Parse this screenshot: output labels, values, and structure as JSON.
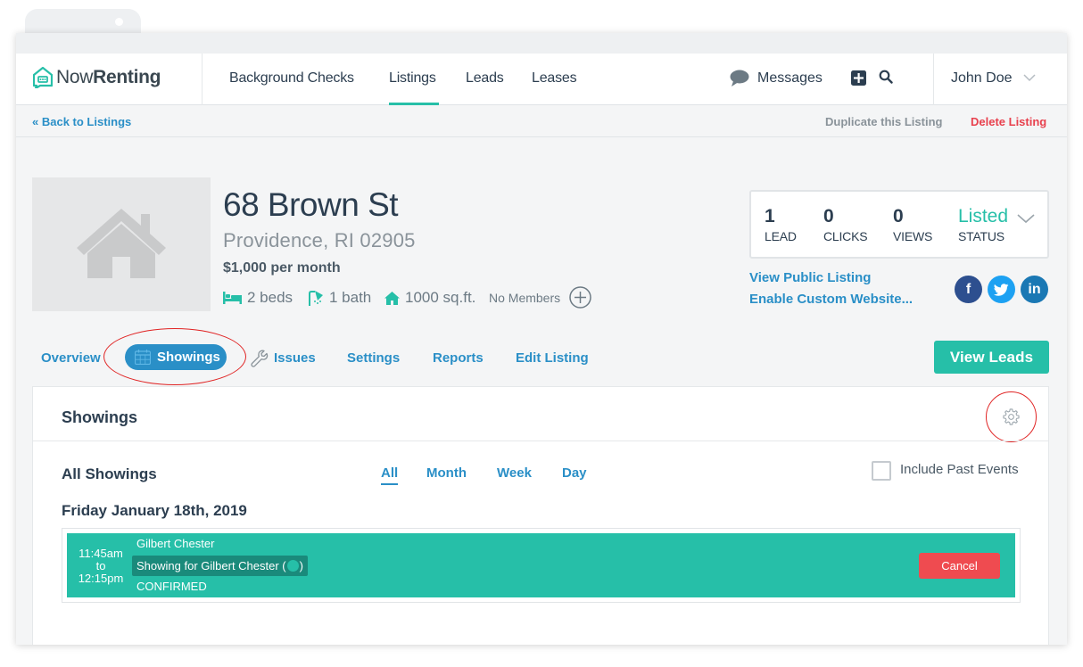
{
  "navbar": {
    "logo_light": "Now",
    "logo_bold": "Renting",
    "items": [
      "Background Checks",
      "Listings",
      "Leads",
      "Leases"
    ],
    "active_item": "Listings",
    "messages_label": "Messages",
    "user_name": "John Doe"
  },
  "subbar": {
    "back_label": "« Back to Listings",
    "duplicate_label": "Duplicate this Listing",
    "delete_label": "Delete Listing"
  },
  "listing": {
    "address_line1": "68 Brown St",
    "address_line2": "Providence, RI 02905",
    "price": "$1,000 per month",
    "beds": "2 beds",
    "baths": "1 bath",
    "sqft": "1000 sq.ft.",
    "members": "No Members"
  },
  "stats": {
    "lead_count": "1",
    "lead_label": "LEAD",
    "clicks_count": "0",
    "clicks_label": "CLICKS",
    "views_count": "0",
    "views_label": "VIEWS",
    "status_value": "Listed",
    "status_label": "STATUS"
  },
  "links": {
    "view_public": "View Public Listing",
    "custom_website": "Enable Custom Website..."
  },
  "social": {
    "facebook": "f",
    "twitter": "t",
    "linkedin": "in"
  },
  "subnav": {
    "overview": "Overview",
    "showings": "Showings",
    "issues": "Issues",
    "settings": "Settings",
    "reports": "Reports",
    "edit": "Edit Listing",
    "view_leads": "View Leads"
  },
  "panel": {
    "title": "Showings",
    "all_showings": "All Showings",
    "filters": [
      "All",
      "Month",
      "Week",
      "Day"
    ],
    "active_filter": "All",
    "include_past": "Include Past Events",
    "date_heading": "Friday January 18th, 2019"
  },
  "event": {
    "time_start": "11:45am",
    "time_sep": "to",
    "time_end": "12:15pm",
    "attendee": "Gilbert Chester",
    "description_prefix": "Showing for Gilbert Chester (",
    "description_suffix": ")",
    "status": "CONFIRMED",
    "cancel_label": "Cancel"
  },
  "colors": {
    "brand_teal": "#26bfa8",
    "link_blue": "#2a8fc7",
    "danger_red": "#e8414e",
    "annotation_red": "#e02424"
  }
}
